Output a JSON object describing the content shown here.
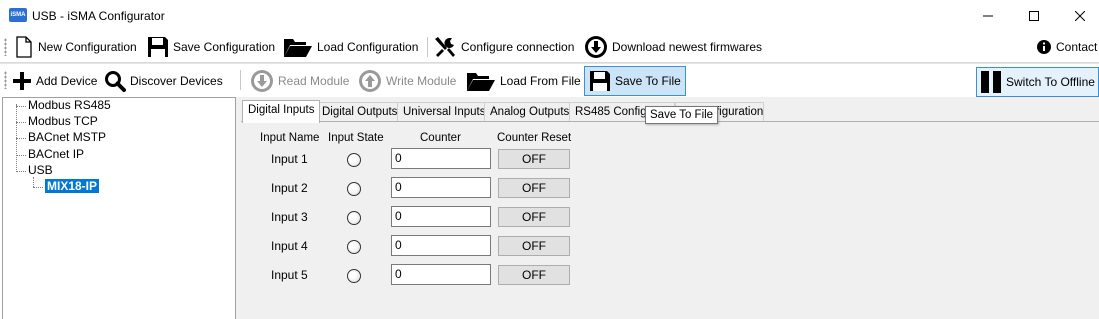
{
  "window": {
    "app_icon_text": "iSMA",
    "title": "USB - iSMA Configurator"
  },
  "toolbar_main": {
    "new_configuration": "New Configuration",
    "save_configuration": "Save Configuration",
    "load_configuration": "Load Configuration",
    "configure_connection": "Configure connection",
    "download_firmwares": "Download newest firmwares",
    "contact": "Contact"
  },
  "toolbar_device": {
    "add_device": "Add Device",
    "discover_devices": "Discover Devices",
    "read_module": "Read Module",
    "write_module": "Write Module",
    "load_from_file": "Load From File",
    "save_to_file": "Save To File",
    "switch_offline": "Switch To Offline"
  },
  "tree": {
    "items": [
      "Modbus RS485",
      "Modbus TCP",
      "BACnet MSTP",
      "BACnet IP",
      "USB"
    ],
    "child": "MIX18-IP"
  },
  "tabs": [
    {
      "label": "Digital Inputs",
      "active": true
    },
    {
      "label": "Digital Outputs"
    },
    {
      "label": "Universal Inputs"
    },
    {
      "label": "Analog Outputs"
    },
    {
      "label": "RS485 Configuration"
    },
    {
      "label": "IP Configuration"
    }
  ],
  "tooltip": "Save To File",
  "table": {
    "headers": {
      "input_name": "Input Name",
      "input_state": "Input State",
      "counter": "Counter",
      "counter_reset": "Counter Reset"
    },
    "rows": [
      {
        "name": "Input 1",
        "counter": "0",
        "reset": "OFF"
      },
      {
        "name": "Input 2",
        "counter": "0",
        "reset": "OFF"
      },
      {
        "name": "Input 3",
        "counter": "0",
        "reset": "OFF"
      },
      {
        "name": "Input 4",
        "counter": "0",
        "reset": "OFF"
      },
      {
        "name": "Input 5",
        "counter": "0",
        "reset": "OFF"
      }
    ]
  },
  "colors": {
    "accent": "#0078d7",
    "selection_bg": "#cce4f7",
    "panel_bg": "#f0f0f0"
  }
}
